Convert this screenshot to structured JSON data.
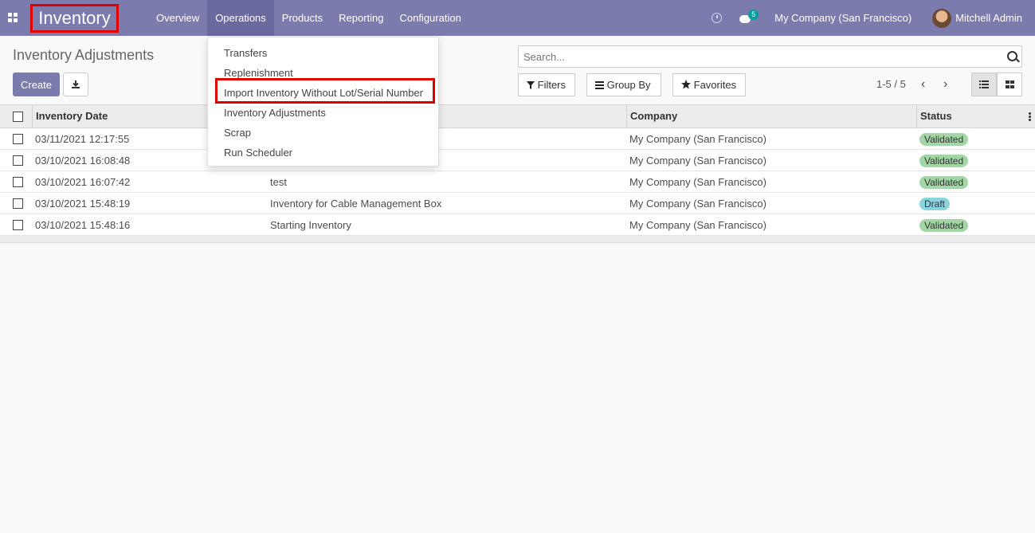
{
  "navbar": {
    "brand": "Inventory",
    "menu": [
      "Overview",
      "Operations",
      "Products",
      "Reporting",
      "Configuration"
    ],
    "notification_count": "5",
    "company": "My Company (San Francisco)",
    "user": "Mitchell Admin",
    "accent_color": "#7c7bad"
  },
  "control_panel": {
    "title": "Inventory Adjustments",
    "create_label": "Create",
    "search_placeholder": "Search...",
    "filters_label": "Filters",
    "group_by_label": "Group By",
    "favorites_label": "Favorites",
    "pager": "1-5 / 5"
  },
  "dropdown": {
    "items": [
      "Transfers",
      "Replenishment",
      "Import Inventory Without Lot/Serial Number",
      "Inventory Adjustments",
      "Scrap",
      "Run Scheduler"
    ]
  },
  "table": {
    "headers": {
      "date": "Inventory Date",
      "company": "Company",
      "status": "Status"
    },
    "rows": [
      {
        "date": "03/11/2021 12:17:55",
        "reference": "",
        "company": "My Company (San Francisco)",
        "status": "Validated"
      },
      {
        "date": "03/10/2021 16:08:48",
        "reference": "",
        "company": "My Company (San Francisco)",
        "status": "Validated"
      },
      {
        "date": "03/10/2021 16:07:42",
        "reference": "test",
        "company": "My Company (San Francisco)",
        "status": "Validated"
      },
      {
        "date": "03/10/2021 15:48:19",
        "reference": "Inventory for Cable Management Box",
        "company": "My Company (San Francisco)",
        "status": "Draft"
      },
      {
        "date": "03/10/2021 15:48:16",
        "reference": "Starting Inventory",
        "company": "My Company (San Francisco)",
        "status": "Validated"
      }
    ]
  }
}
